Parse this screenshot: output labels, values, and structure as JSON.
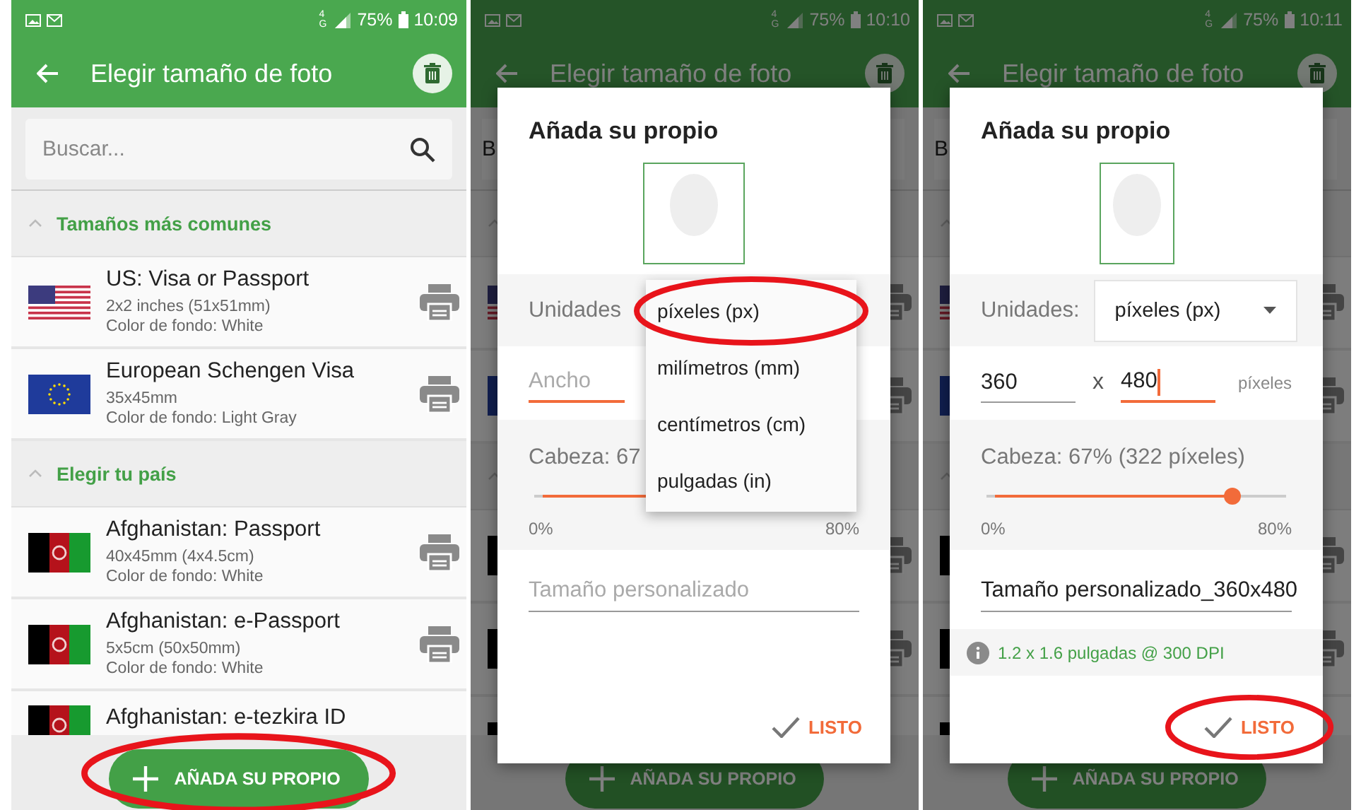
{
  "screens": [
    {
      "kind": "list",
      "status": {
        "network": "4G",
        "battery": "75%",
        "time": "10:09"
      },
      "app_bar": {
        "title": "Elegir tamaño de foto"
      },
      "search": {
        "placeholder": "Buscar..."
      },
      "sections": [
        {
          "title": "Tamaños más comunes",
          "expanded": true,
          "items": [
            {
              "kind": "us",
              "name": "US: Visa or Passport",
              "size": "2x2 inches (51x51mm)",
              "background": "Color de fondo: White"
            },
            {
              "kind": "eu",
              "name": "European Schengen Visa",
              "size": "35x45mm",
              "background": "Color de fondo: Light Gray"
            }
          ]
        },
        {
          "title": "Elegir tu país",
          "expanded": true,
          "items": [
            {
              "kind": "af",
              "name": "Afghanistan: Passport",
              "size": "40x45mm (4x4.5cm)",
              "background": "Color de fondo: White"
            },
            {
              "kind": "af",
              "name": "Afghanistan: e-Passport",
              "size": "5x5cm (50x50mm)",
              "background": "Color de fondo: White"
            },
            {
              "kind": "af",
              "name": "Afghanistan: e-tezkira ID"
            }
          ]
        }
      ],
      "add_button": {
        "label": "AÑADA SU PROPIO",
        "highlighted": true
      }
    },
    {
      "kind": "dialog",
      "status": {
        "network": "4G",
        "battery": "75%",
        "time": "10:10"
      },
      "app_bar": {
        "title": "Elegir tamaño de foto"
      },
      "search_text": "B",
      "rows": [
        {
          "kind": "us"
        },
        {
          "kind": "eu"
        },
        {
          "kind": "af"
        },
        {
          "kind": "af"
        },
        {
          "kind": "af"
        }
      ],
      "add_button": {
        "label": "AÑADA SU PROPIO"
      },
      "dialog": {
        "title": "Añada su propio",
        "preview": {
          "kind": "square"
        },
        "units": {
          "label": "Unidades",
          "menu": [
            {
              "label": "píxeles (px)",
              "highlighted": true
            },
            {
              "label": "milímetros (mm)",
              "highlighted": false
            },
            {
              "label": "centímetros (cm)",
              "highlighted": false
            },
            {
              "label": "pulgadas (in)",
              "highlighted": false
            }
          ]
        },
        "width": {
          "placeholder": "Ancho",
          "focused": true
        },
        "head": {
          "label": "Cabeza: 67",
          "level": 0.84,
          "min": "0%",
          "max": "80%"
        },
        "name": {
          "placeholder": "Tamaño personalizado"
        },
        "done": {
          "label": "LISTO",
          "highlighted": false
        }
      }
    },
    {
      "kind": "dialog",
      "status": {
        "network": "4G",
        "battery": "75%",
        "time": "10:11"
      },
      "app_bar": {
        "title": "Elegir tamaño de foto"
      },
      "search_text": "B",
      "rows": [
        {
          "kind": "us"
        },
        {
          "kind": "eu"
        },
        {
          "kind": "af"
        },
        {
          "kind": "af"
        },
        {
          "kind": "af"
        }
      ],
      "add_button": {
        "label": "AÑADA SU PROPIO"
      },
      "dialog": {
        "title": "Añada su propio",
        "preview": {
          "kind": "portrait"
        },
        "units": {
          "label": "Unidades:",
          "value": "píxeles (px)"
        },
        "width": {
          "value": "360",
          "focused": false
        },
        "times": "x",
        "height": {
          "value": "480",
          "focused": true
        },
        "unit_suffix": "píxeles",
        "head": {
          "label": "Cabeza: 67% (322 píxeles)",
          "level": 0.84,
          "min": "0%",
          "max": "80%"
        },
        "name": {
          "value": "Tamaño personalizado_360x480"
        },
        "info": "1.2 x 1.6 pulgadas @ 300 DPI",
        "done": {
          "label": "LISTO",
          "highlighted": true
        }
      }
    }
  ]
}
